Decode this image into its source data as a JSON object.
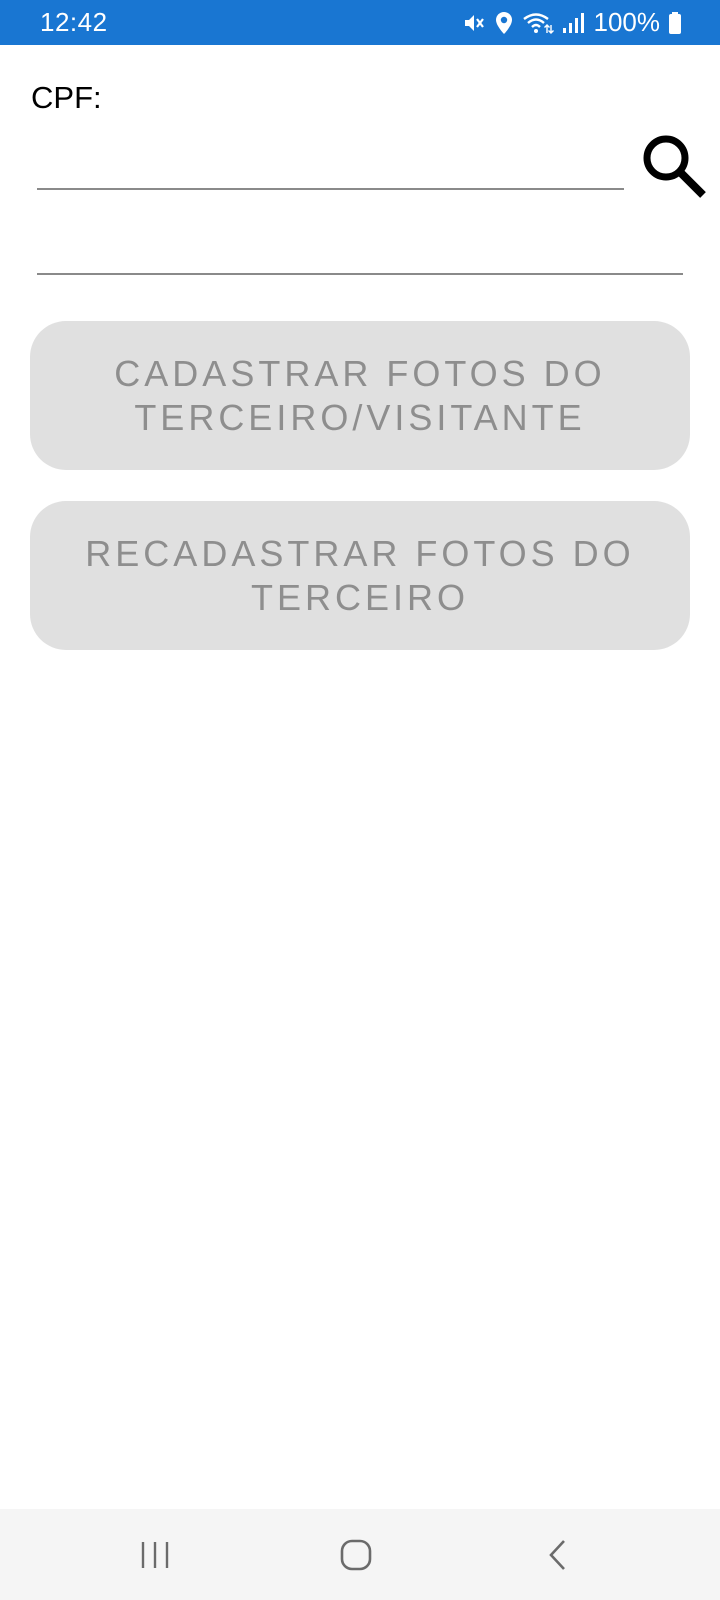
{
  "status_bar": {
    "time": "12:42",
    "battery": "100%",
    "icons": [
      "mute-icon",
      "location-icon",
      "wifi-icon",
      "signal-icon",
      "battery-icon"
    ],
    "background": "#1976d2"
  },
  "form": {
    "cpf_label": "CPF:",
    "cpf_value": "",
    "name_value": "",
    "search_icon": "search-icon"
  },
  "buttons": {
    "cadastrar_label": "CADASTRAR FOTOS DO TERCEIRO/VISITANTE",
    "recadastrar_label": "RECADASTRAR FOTOS DO TERCEIRO",
    "disabled_background": "#e0e0e0",
    "disabled_text_color": "#8e8e8e"
  },
  "nav_bar": {
    "icons": [
      "recents-icon",
      "home-icon",
      "back-icon"
    ]
  }
}
